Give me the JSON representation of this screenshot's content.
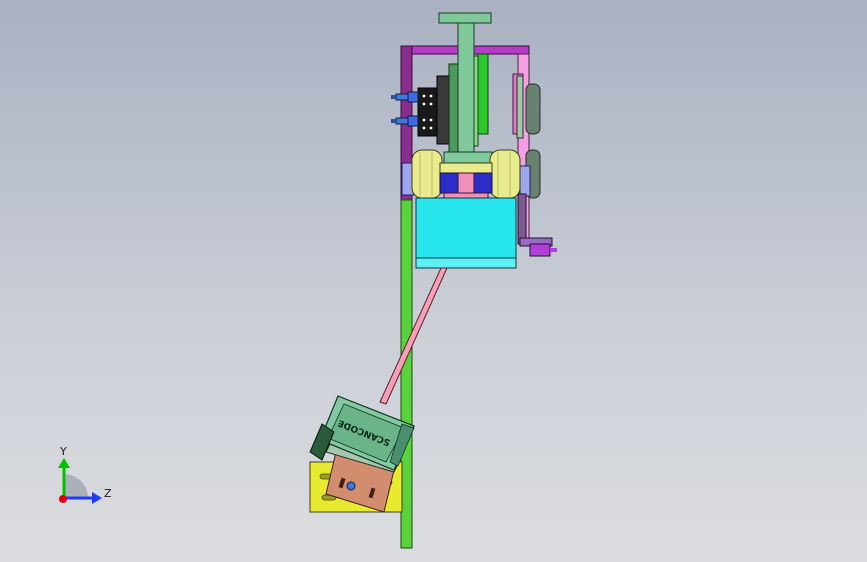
{
  "viewport": {
    "background_top": "#a9b1c2",
    "background_bottom": "#dcdde0"
  },
  "triad": {
    "y_label": "Y",
    "z_label": "Z",
    "y_color": "#00c000",
    "z_color": "#1e3cff",
    "origin_color": "#e00000"
  },
  "scanner": {
    "brand_text": "SCANCODE"
  },
  "parts": [
    {
      "name": "top-t-bracket",
      "color": "#7fc99a"
    },
    {
      "name": "purple-frame",
      "color": "#b43cc8"
    },
    {
      "name": "green-post",
      "color": "#5ad23c"
    },
    {
      "name": "cyan-block",
      "color": "#28e6ee"
    },
    {
      "name": "yellow-rollers",
      "color": "#e8ec8c"
    },
    {
      "name": "scanner-body",
      "color": "#82c8a0"
    },
    {
      "name": "yellow-base-plate",
      "color": "#e8ea30"
    },
    {
      "name": "copper-mount",
      "color": "#d28c6e"
    },
    {
      "name": "pink-rod",
      "color": "#f5a0b4"
    }
  ]
}
